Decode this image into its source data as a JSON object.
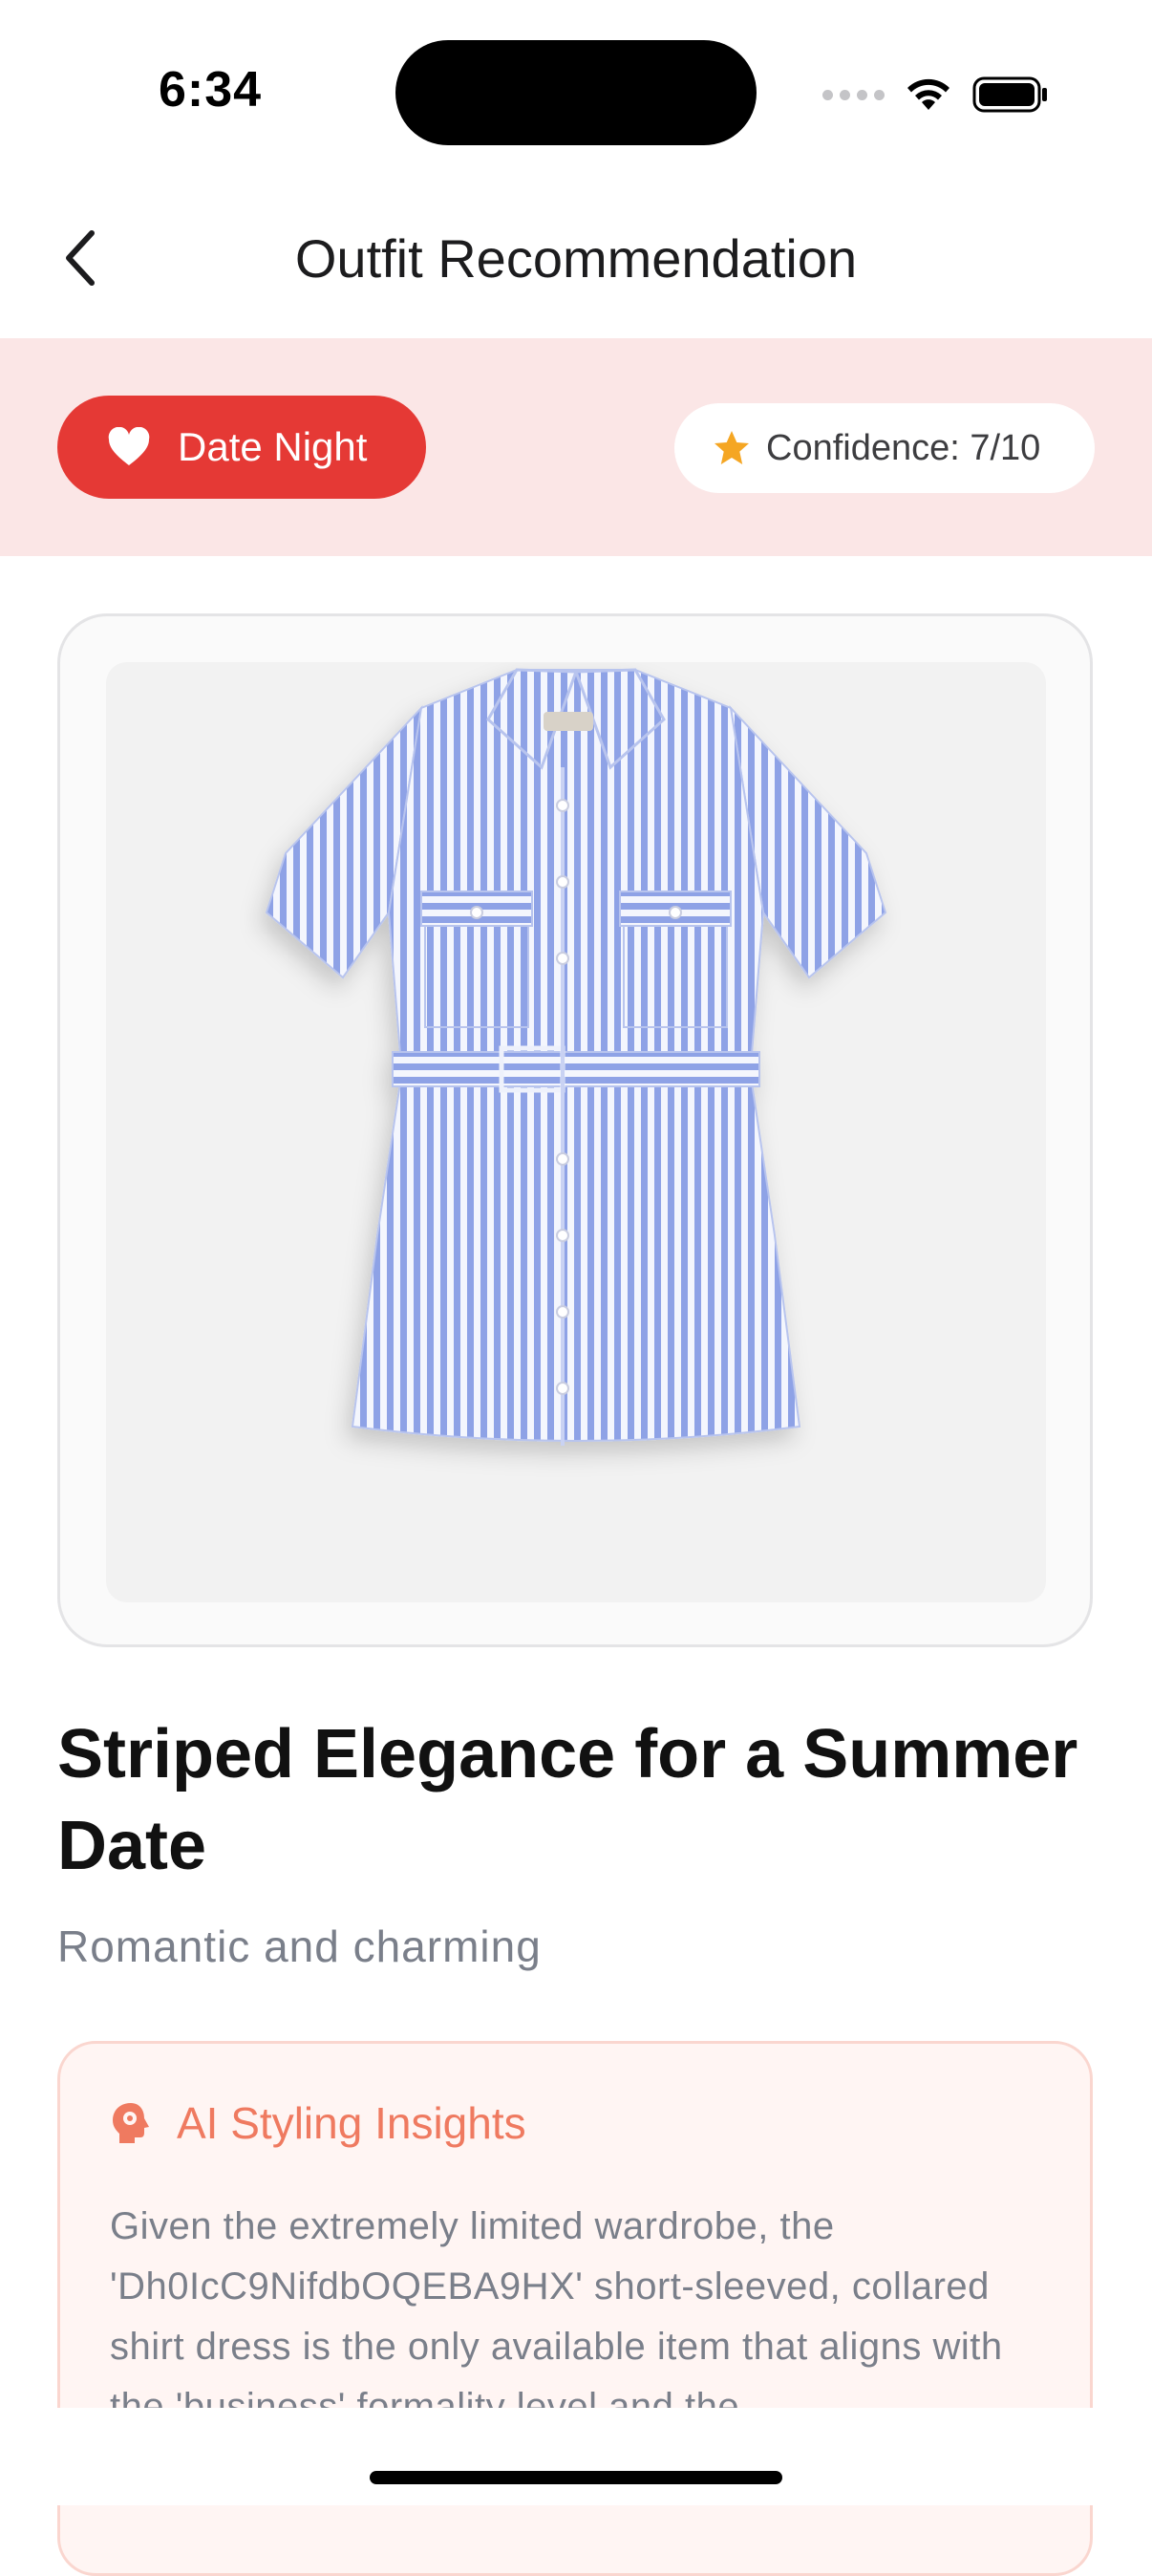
{
  "status_bar": {
    "time": "6:34"
  },
  "header": {
    "title": "Outfit Recommendation",
    "back_icon": "chevron-left-icon"
  },
  "occasion": {
    "label": "Date Night",
    "icon": "heart-icon",
    "color": "#e53935",
    "band_color": "#fbe6e6"
  },
  "confidence": {
    "label": "Confidence: 7/10",
    "icon": "star-icon",
    "star_color": "#f5a623"
  },
  "outfit": {
    "title": "Striped Elegance for a Summer Date",
    "subtitle": "Romantic and charming"
  },
  "insights": {
    "title": "AI Styling Insights",
    "icon": "brain-head-icon",
    "accent_color": "#ef7a60",
    "body": "Given the extremely limited wardrobe, the 'Dh0IcC9NifdbOQEBA9HX' short-sleeved, collared shirt dress is the only available item that aligns with the 'business' formality level and the"
  }
}
